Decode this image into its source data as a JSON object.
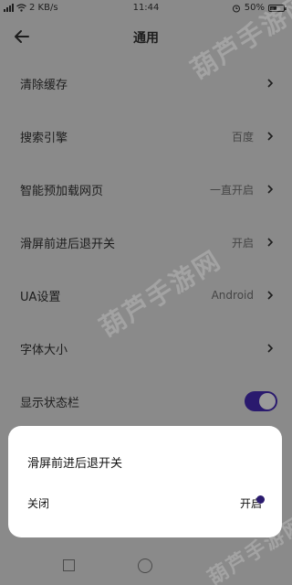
{
  "status_bar": {
    "network_speed": "2 KB/s",
    "time": "11:44",
    "battery_percent": "50%",
    "battery_level": 0.5,
    "icons": [
      "signal-icon",
      "wifi-icon",
      "alarm-icon",
      "battery-icon"
    ]
  },
  "header": {
    "title": "通用",
    "back_icon": "arrow-left-icon"
  },
  "settings": [
    {
      "label": "清除缓存",
      "value": ""
    },
    {
      "label": "搜索引擎",
      "value": "百度"
    },
    {
      "label": "智能预加载网页",
      "value": "一直开启"
    },
    {
      "label": "滑屏前进后退开关",
      "value": "开启"
    },
    {
      "label": "UA设置",
      "value": "Android"
    },
    {
      "label": "字体大小",
      "value": ""
    },
    {
      "label": "显示状态栏",
      "toggle_on": true
    }
  ],
  "dialog": {
    "title": "滑屏前进后退开关",
    "options": [
      "关闭",
      "开启"
    ],
    "selected": "开启"
  },
  "watermark": "葫芦手游网",
  "colors": {
    "accent": "#2a1a6e",
    "overlay_background": "#8a8a8a",
    "dialog_background": "#ffffff"
  }
}
